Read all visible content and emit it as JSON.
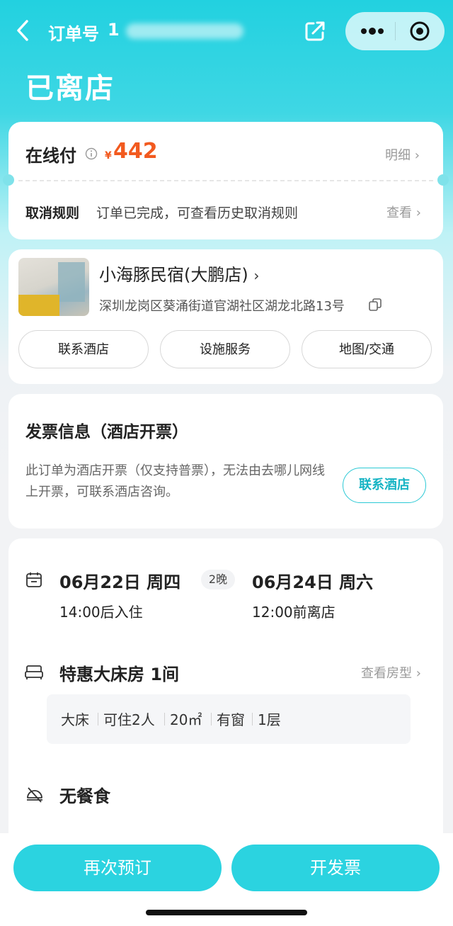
{
  "header": {
    "order_label": "订单号",
    "order_number_visible": "1",
    "status": "已离店"
  },
  "payment": {
    "title": "在线付",
    "currency": "¥",
    "amount": "442",
    "detail_link": "明细",
    "cancel_title": "取消规则",
    "cancel_text": "订单已完成，可查看历史取消规则",
    "cancel_link": "查看"
  },
  "hotel": {
    "name": "小海豚民宿(大鹏店)",
    "address": "深圳龙岗区葵涌街道官湖社区湖龙北路13号",
    "buttons": [
      "联系酒店",
      "设施服务",
      "地图/交通"
    ]
  },
  "invoice": {
    "title": "发票信息（酒店开票）",
    "text": "此订单为酒店开票（仅支持普票），无法由去哪儿网线上开票，可联系酒店咨询。",
    "button": "联系酒店"
  },
  "stay": {
    "checkin_date": "06月22日 周四",
    "nights": "2晚",
    "checkout_date": "06月24日 周六",
    "checkin_time": "14:00后入住",
    "checkout_time": "12:00前离店",
    "room": "特惠大床房 1间",
    "view_room": "查看房型",
    "tags": [
      "大床",
      "可住2人",
      "20㎡",
      "有窗",
      "1层"
    ],
    "meal": "无餐食"
  },
  "actions": {
    "rebook": "再次预订",
    "invoice": "开发票"
  },
  "colors": {
    "accent": "#2BD3E0",
    "price": "#F25A1F"
  }
}
